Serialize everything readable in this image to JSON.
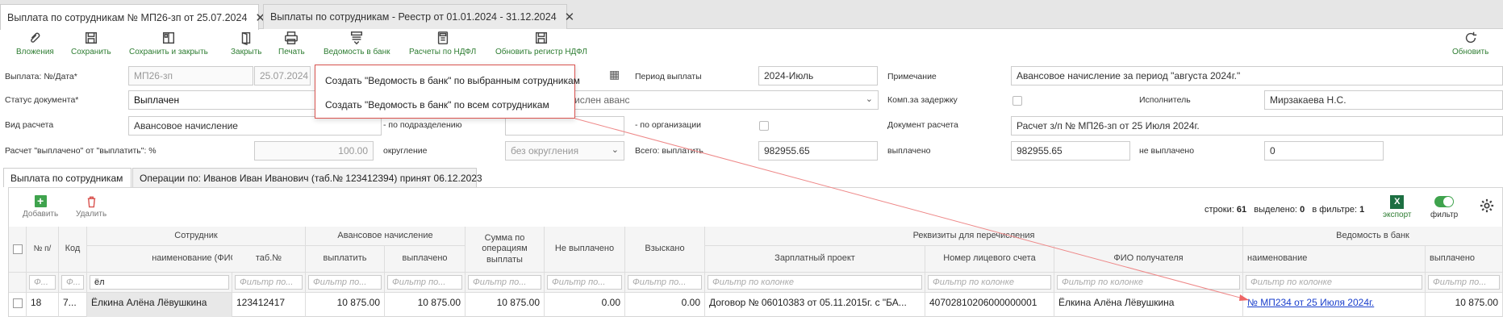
{
  "tabs": [
    {
      "label": "Выплата по сотрудникам № МП26-зп от 25.07.2024",
      "close": "✕"
    },
    {
      "label": "Выплаты по сотрудникам - Реестр от 01.01.2024 - 31.12.2024",
      "close": "✕"
    }
  ],
  "toolbar": {
    "attachments": "Вложения",
    "save": "Сохранить",
    "save_close": "Сохранить и закрыть",
    "close": "Закрыть",
    "print": "Печать",
    "bank_statement": "Ведомость в банк",
    "ndfl": "Расчеты по НДФЛ",
    "update_ndfl": "Обновить регистр НДФЛ",
    "refresh": "Обновить"
  },
  "form": {
    "payment_label": "Выплата: №/Дата*",
    "payment_number": "МП26-зп",
    "payment_date": "25.07.2024",
    "period_label": "Период выплаты",
    "period_value": "2024-Июль",
    "note_label": "Примечание",
    "note_value": "Авансовое начисление за период \"августа 2024г.\"",
    "status_label": "Статус документа*",
    "status_value": "Выплачен",
    "accrued_value": "ислен аванс",
    "delay_comp_label": "Комп.за задержку",
    "executor_label": "Исполнитель",
    "executor_value": "Мирзакаева Н.С.",
    "calc_type_label": "Вид расчета",
    "calc_type_value": "Авансовое начисление",
    "by_division_label": "- по подразделению",
    "by_org_label": "- по организации",
    "calc_doc_label": "Документ расчета",
    "calc_doc_value": "Расчет з/п № МП26-зп от 25 Июля 2024г.",
    "pct_label": "Расчет \"выплачено\" от \"выплатить\": %",
    "pct_value": "100.00",
    "rounding_label": "округление",
    "rounding_value": "без округления",
    "total_pay_label": "Всего: выплатить",
    "total_pay_value": "982955.65",
    "paid_label": "выплачено",
    "paid_value": "982955.65",
    "unpaid_label": "не выплачено",
    "unpaid_value": "0"
  },
  "popup": {
    "item1": "Создать \"Ведомость в банк\" по выбранным сотрудникам",
    "item2": "Создать \"Ведомость в банк\" по всем сотрудникам"
  },
  "inner_tabs": [
    "Выплата по сотрудникам",
    "Операции по: Иванов Иван Иванович (таб.№ 123412394) принят 06.12.2023"
  ],
  "grid_toolbar": {
    "add": "Добавить",
    "delete": "Удалить",
    "rows_label": "строки:",
    "rows_value": "61",
    "selected_label": "выделено:",
    "selected_value": "0",
    "filtered_label": "в фильтре:",
    "filtered_value": "1",
    "export": "экспорт",
    "filter": "фильтр"
  },
  "table": {
    "group_employee": "Сотрудник",
    "group_advance": "Авансовое начисление",
    "group_requisites": "Реквизиты для перечисления",
    "group_bank": "Ведомость в банк",
    "col_num": "№ п/",
    "col_code": "Код",
    "col_name": "наименование (ФИО)",
    "col_tab": "таб.№",
    "col_pay": "выплатить",
    "col_paid": "выплачено",
    "col_sum_ops": "Сумма по операциям выплаты",
    "col_unpaid": "Не выплачено",
    "col_recovered": "Взыскано",
    "col_salary_project": "Зарплатный проект",
    "col_account": "Номер лицевого счета",
    "col_recipient": "ФИО получателя",
    "col_bank_name": "наименование",
    "col_bank_paid": "выплачено",
    "filter_placeholder_short": "Ф...",
    "filter_placeholder": "Фильтр по...",
    "filter_placeholder_long": "Фильтр по колонке",
    "name_filter_value": "ёл",
    "row": {
      "num": "18",
      "code": "7...",
      "name": "Ёлкина Алёна Лёвушкина",
      "tab": "123412417",
      "pay": "10 875.00",
      "paid": "10 875.00",
      "sum_ops": "10 875.00",
      "unpaid": "0.00",
      "recovered": "0.00",
      "salary_project": "Договор № 06010383 от 05.11.2015г. с \"БА...",
      "account": "40702810206000000001",
      "recipient": "Ёлкина Алёна Лёвушкина",
      "bank_name": "№ МП234 от 25 Июля 2024г.",
      "bank_paid": "10 875.00"
    }
  },
  "colors": {
    "accent_green": "#2e7d32",
    "popup_border": "#d9534f",
    "link_blue": "#1a3fcc"
  }
}
